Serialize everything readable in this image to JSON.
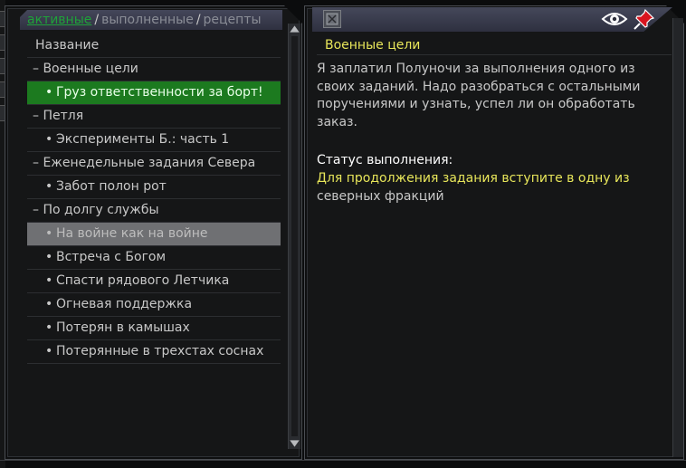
{
  "tabs": [
    {
      "label": "активные",
      "active": true
    },
    {
      "label": "выполненные",
      "active": false
    },
    {
      "label": "рецепты",
      "active": false
    }
  ],
  "tab_separator": "/",
  "list": {
    "header": "Название",
    "group_prefix": "–",
    "quest_prefix": "•",
    "rows": [
      {
        "type": "group",
        "label": "Военные цели"
      },
      {
        "type": "quest",
        "label": "Груз ответственности за борт!",
        "state": "selected"
      },
      {
        "type": "group",
        "label": "Петля"
      },
      {
        "type": "quest",
        "label": "Эксперименты Б.: часть 1"
      },
      {
        "type": "group",
        "label": "Еженедельные задания Севера"
      },
      {
        "type": "quest",
        "label": "Забот полон рот"
      },
      {
        "type": "group",
        "label": "По долгу службы"
      },
      {
        "type": "quest",
        "label": "На войне как на войне",
        "state": "dimmed"
      },
      {
        "type": "quest",
        "label": "Встреча с Богом"
      },
      {
        "type": "quest",
        "label": "Спасти рядового Летчика"
      },
      {
        "type": "quest",
        "label": "Огневая поддержка"
      },
      {
        "type": "quest",
        "label": "Потерян в камышах"
      },
      {
        "type": "quest",
        "label": "Потерянные в трехстах соснах"
      }
    ]
  },
  "detail": {
    "title": "Военные цели",
    "description": "Я заплатил Полуночи за выполнения одного из своих заданий. Надо разобраться с остальными поручениями и узнать, успел ли он обработать заказ.",
    "status_label": "Статус выполнения:",
    "status_highlight": "Для продолжения задания вступите в одну из",
    "status_rest": "северных фракций"
  },
  "icons": {
    "watch": "eye-icon",
    "pin": "pin-icon",
    "quest_badge": "quest-badge-icon"
  },
  "colors": {
    "active_tab": "#1fa23a",
    "selected_row": "#1c7a1f",
    "title_yellow": "#e8e65a",
    "pin_red": "#d8141e"
  }
}
